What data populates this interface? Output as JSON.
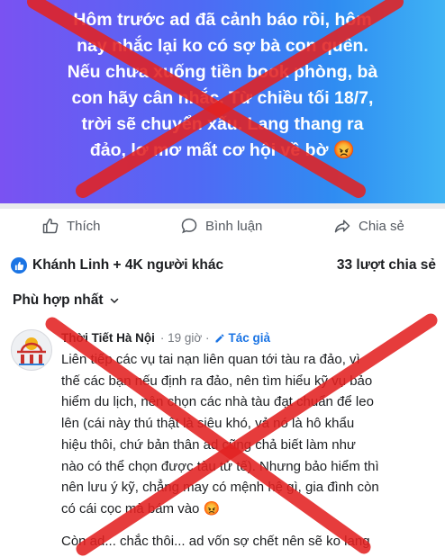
{
  "post": {
    "lines": [
      "Hôm trước ad đã cảnh báo rồi, hôm",
      "nay nhắc lại ko có sợ bà con quên.",
      "Nếu chưa xuống tiền book phòng, bà",
      "con hãy cân nhắc. Từ chiều tối 18/7,",
      "trời sẽ chuyển xấu. Lang thang ra",
      "đảo, lơ mơ mất cơ hội về bờ 😡"
    ]
  },
  "actions": {
    "like": "Thích",
    "comment": "Bình luận",
    "share": "Chia sẻ"
  },
  "reactions": {
    "summary": "Khánh Linh + 4K người khác",
    "shares": "33 lượt chia sẻ"
  },
  "sort": {
    "label": "Phù hợp nhất"
  },
  "comment": {
    "author": "Thời Tiết Hà Nội",
    "time": "· 19 giờ ·",
    "badge": "Tác giả",
    "lines": [
      "Liên tiếp các vụ tai nạn liên quan tới tàu ra đảo, vì",
      "thế các bạn nếu định ra đảo, nên tìm hiểu kỹ vụ bảo",
      "hiểm du lịch, nên chọn các nhà tàu đạt chuẩn để leo",
      "lên (cái này thú thật là siêu khó, vả nó là hô khẩu",
      "hiệu thôi, chứ bản thân ad cũng chả biết làm như",
      "nào có thể chọn được tàu tử tế). Nhưng bảo hiểm thì",
      "nên lưu ý kỹ, chẳng may có mệnh hệ gì, gia đình còn",
      "có cái cọc mà bám vào 😡"
    ],
    "tail": "Còn ad... chắc thôi... ad vốn sợ chết nên sẽ ko lang"
  },
  "colors": {
    "cross": "#e32222",
    "accent": "#1b74e4"
  },
  "icons": [
    "like-icon",
    "comment-icon",
    "share-icon",
    "chevron-down-icon",
    "pencil-icon",
    "avatar-icon"
  ]
}
